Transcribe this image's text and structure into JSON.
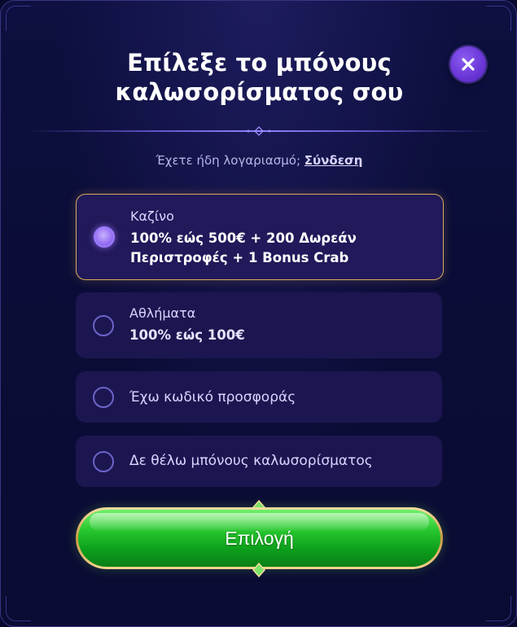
{
  "modal": {
    "title_line1": "Επίλεξε το μπόνους",
    "title_line2": "καλωσορίσματος σου",
    "close_icon": "close-icon"
  },
  "login": {
    "prompt": "Έχετε ήδη λογαριασμό;",
    "link": "Σύνδεση"
  },
  "options": [
    {
      "label": "Καζίνο",
      "desc_line1": "100% εώς 500€ + 200 Δωρεάν",
      "desc_line2": "Περιστροφές + 1 Bonus Crab",
      "selected": true
    },
    {
      "label": "Αθλήματα",
      "desc_line1": "100% εώς 100€",
      "selected": false
    },
    {
      "label": "Έχω κωδικό προσφοράς",
      "selected": false
    },
    {
      "label": "Δε θέλω μπόνους καλωσορίσματος",
      "selected": false
    }
  ],
  "action": {
    "select_label": "Επιλογή"
  },
  "colors": {
    "accent_gold": "#d7a85a",
    "button_green": "#28c82f",
    "close_purple": "#6a35d6"
  }
}
